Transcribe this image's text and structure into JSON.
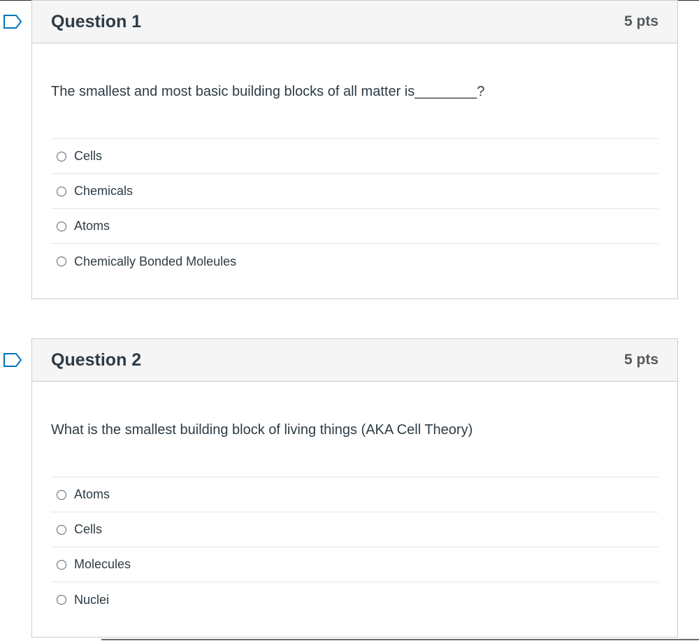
{
  "questions": [
    {
      "title": "Question 1",
      "points": "5 pts",
      "text": "The smallest and most basic building blocks of all matter is________?",
      "answers": [
        "Cells",
        "Chemicals",
        "Atoms",
        "Chemically Bonded Moleules"
      ]
    },
    {
      "title": "Question 2",
      "points": "5 pts",
      "text": "What is the smallest building block of living things (AKA Cell Theory)",
      "answers": [
        "Atoms",
        "Cells",
        "Molecules",
        "Nuclei"
      ]
    }
  ],
  "colors": {
    "flag": "#0374b5",
    "header_bg": "#f5f5f5",
    "border": "#c7cdd1",
    "text": "#2d3b45"
  },
  "icons": {
    "flag": "bookmark-flag-icon",
    "radio": "radio-button-icon"
  }
}
